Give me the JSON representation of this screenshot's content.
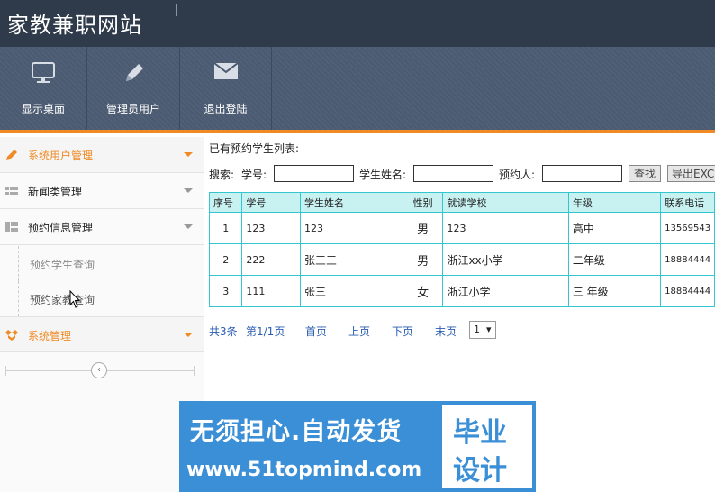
{
  "header": {
    "title": "家教兼职网站"
  },
  "toolbar": {
    "items": [
      {
        "label": "显示桌面",
        "icon": "monitor-icon"
      },
      {
        "label": "管理员用户",
        "icon": "pencil-icon"
      },
      {
        "label": "退出登陆",
        "icon": "envelope-icon"
      }
    ]
  },
  "sidebar": {
    "menus": [
      {
        "label": "系统用户管理",
        "icon": "pencil-icon"
      },
      {
        "label": "新闻类管理",
        "icon": "grid-icon"
      },
      {
        "label": "预约信息管理",
        "icon": "layout-icon"
      },
      {
        "label": "系统管理",
        "icon": "dropbox-icon"
      }
    ],
    "submenus": [
      {
        "label": "预约学生查询"
      },
      {
        "label": "预约家教查询"
      }
    ]
  },
  "main": {
    "list_title": "已有预约学生列表:",
    "search": {
      "label_search": "搜索:",
      "label_id": "学号:",
      "label_name": "学生姓名:",
      "label_booker": "预约人:",
      "btn_find": "查找",
      "btn_export": "导出EXCEL"
    },
    "table": {
      "headers": [
        "序号",
        "学号",
        "学生姓名",
        "性别",
        "就读学校",
        "年级",
        "联系电话"
      ],
      "rows": [
        [
          "1",
          "123",
          "123",
          "男",
          "123",
          "高中",
          "13569543"
        ],
        [
          "2",
          "222",
          "张三三",
          "男",
          "浙江xx小学",
          "二年级",
          "18884444"
        ],
        [
          "3",
          "111",
          "张三",
          "女",
          "浙江小学",
          "三 年级",
          "18884444"
        ]
      ]
    },
    "pager": {
      "total": "共3条",
      "page": "第1/1页",
      "first": "首页",
      "prev": "上页",
      "next": "下页",
      "last": "末页",
      "select": "1"
    }
  },
  "watermark": {
    "slogan": "无须担心.自动发货",
    "url": "www.51topmind.com",
    "box_line1": "毕业",
    "box_line2": "设计"
  },
  "colors": {
    "accent": "#f08a24",
    "header": "#2f3a4a",
    "table_border": "#34c6cf",
    "link": "#2a5db0"
  }
}
